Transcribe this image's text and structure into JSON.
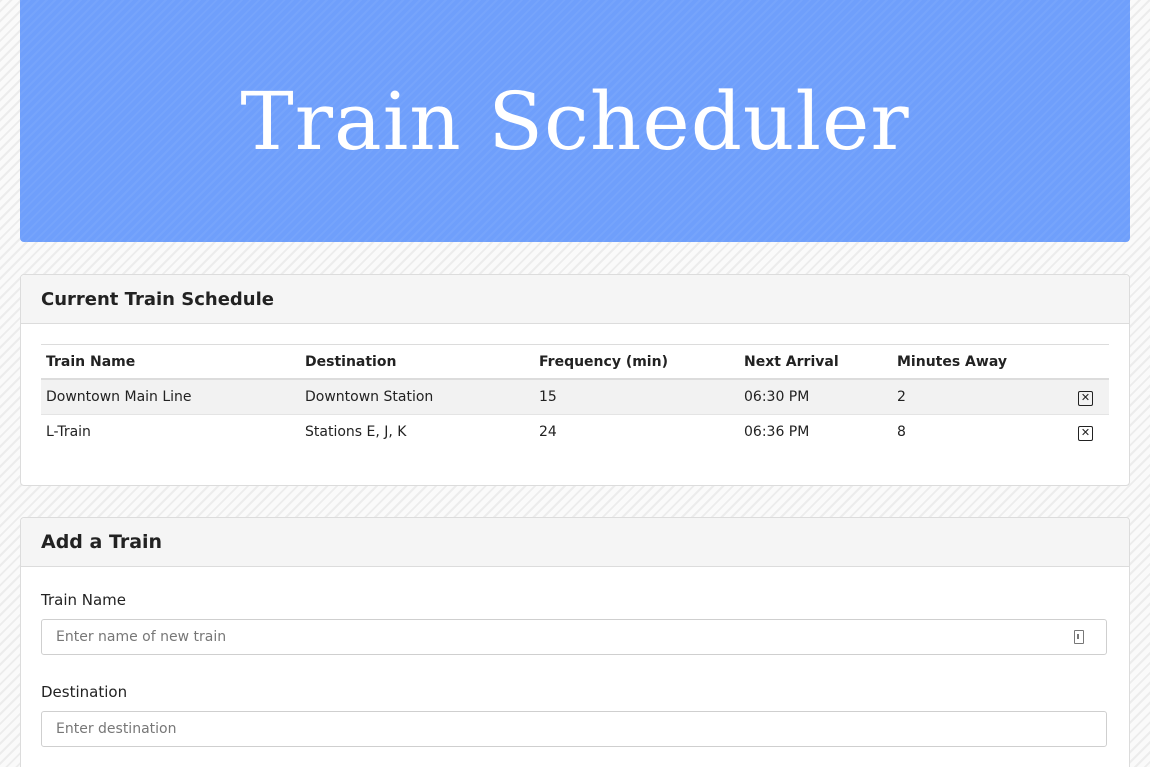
{
  "header": {
    "title": "Train Scheduler",
    "background_color": "#6f9ffb"
  },
  "schedule": {
    "title": "Current Train Schedule",
    "columns": [
      "Train Name",
      "Destination",
      "Frequency (min)",
      "Next Arrival",
      "Minutes Away"
    ],
    "rows": [
      {
        "name": "Downtown Main Line",
        "destination": "Downtown Station",
        "frequency": "15",
        "next_arrival": "06:30 PM",
        "minutes_away": "2",
        "remove_icon": "close-box-icon"
      },
      {
        "name": "L-Train",
        "destination": "Stations E, J, K",
        "frequency": "24",
        "next_arrival": "06:36 PM",
        "minutes_away": "8",
        "remove_icon": "close-box-icon"
      }
    ]
  },
  "add_train": {
    "title": "Add a Train",
    "fields": [
      {
        "label": "Train Name",
        "placeholder": "Enter name of new train",
        "value": ""
      },
      {
        "label": "Destination",
        "placeholder": "Enter destination",
        "value": ""
      }
    ]
  }
}
